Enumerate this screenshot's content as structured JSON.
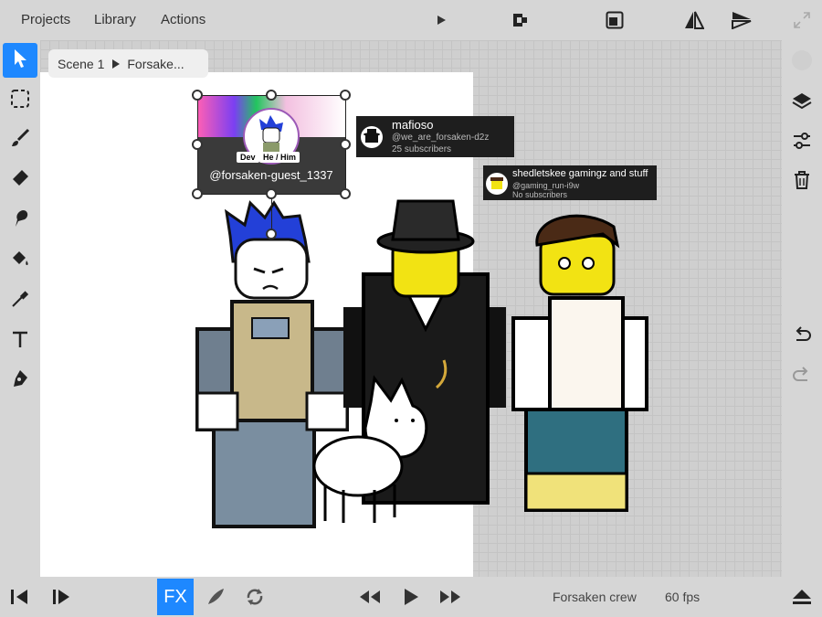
{
  "menu": {
    "projects": "Projects",
    "library": "Library",
    "actions": "Actions"
  },
  "breadcrumb": {
    "scene": "Scene 1",
    "layer": "Forsake..."
  },
  "profile": {
    "dev_badge": "Dev",
    "pronouns_badge": "He / Him",
    "handle": "@forsaken-guest_1337"
  },
  "tooltips": [
    {
      "name": "mafioso",
      "handle": "@we_are_forsaken-d2z",
      "subs": "25 subscribers"
    },
    {
      "name": "shedletskee gamingz and stuff",
      "handle": "@gaming_run-i9w",
      "subs": "No subscribers"
    }
  ],
  "bottom": {
    "fx": "FX",
    "project_name": "Forsaken crew",
    "fps": "60 fps"
  },
  "colors": {
    "accent": "#1e88ff",
    "chrome": "#d6d6d6",
    "canvas": "#ffffff"
  },
  "icons": [
    "select-arrow-icon",
    "marquee-select-icon",
    "brush-icon",
    "eraser-icon",
    "smudge-icon",
    "fill-bucket-icon",
    "eyedropper-icon",
    "text-icon",
    "pen-icon",
    "play-icon",
    "onion-skin-icon",
    "frame-icon",
    "flip-horizontal-icon",
    "flip-vertical-icon",
    "expand-icon",
    "color-circle-icon",
    "layers-icon",
    "sliders-icon",
    "trash-icon",
    "undo-icon",
    "redo-icon",
    "step-back-icon",
    "step-forward-icon",
    "brush-tip-icon",
    "loop-icon",
    "rewind-icon",
    "fast-forward-icon",
    "eject-icon"
  ]
}
